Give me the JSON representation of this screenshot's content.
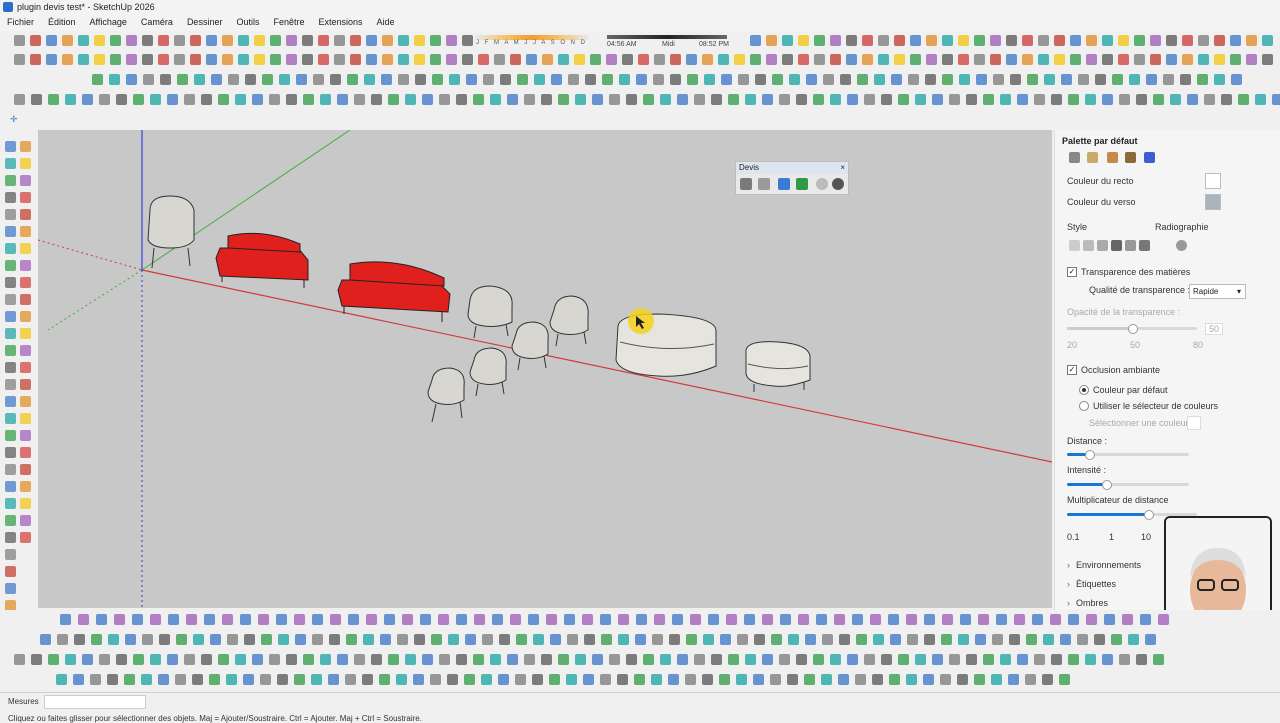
{
  "window": {
    "title": "plugin devis test* - SketchUp 2026"
  },
  "menu": [
    "Fichier",
    "Édition",
    "Affichage",
    "Caméra",
    "Dessiner",
    "Outils",
    "Fenêtre",
    "Extensions",
    "Aide"
  ],
  "timeline": {
    "months": "J F M A M J J A S O N D",
    "time_start": "04:56 AM",
    "time_mid": "Midi",
    "time_end": "08:52 PM"
  },
  "devis": {
    "title": "Devis",
    "close": "×"
  },
  "panel": {
    "title": "Palette par défaut",
    "couleur_recto": "Couleur du recto",
    "couleur_verso": "Couleur du verso",
    "style": "Style",
    "radiographie": "Radiographie",
    "transparence": "Transparence des matières",
    "qualite_label": "Qualité de transparence :",
    "qualite_value": "Rapide",
    "opacite_label": "Opacité de la transparence :",
    "opacite_value": "50",
    "opacite_ticks": [
      "20",
      "50",
      "80"
    ],
    "occlusion": "Occlusion ambiante",
    "couleur_defaut": "Couleur par défaut",
    "selecteur": "Utiliser le sélecteur de couleurs",
    "selectionner": "Sélectionner une couleur",
    "distance": "Distance :",
    "intensite": "Intensité :",
    "multiplicateur": "Multiplicateur de distance",
    "mult_ticks": [
      "0.1",
      "1",
      "10",
      "10"
    ],
    "environnements": "Environnements",
    "etiquettes": "Étiquettes",
    "ombres": "Ombres"
  },
  "controls": {
    "transparence_checked": true,
    "occlusion_checked": true,
    "distance_level": 0.18,
    "intensite_level": 0.32,
    "opacite_level": 0.5,
    "multiplicateur_level": 0.62
  },
  "status": {
    "mesures": "Mesures",
    "hint": "Cliquez ou faites glisser pour sélectionner des objets. Maj = Ajouter/Soustraire. Ctrl = Ajouter. Maj + Ctrl = Soustraire."
  },
  "colors": {
    "sofa_red": "#e0201c",
    "axis_red": "#d23a3a",
    "axis_green": "#3fae3f",
    "axis_blue": "#3c3cd8",
    "accent": "#1976d2"
  }
}
